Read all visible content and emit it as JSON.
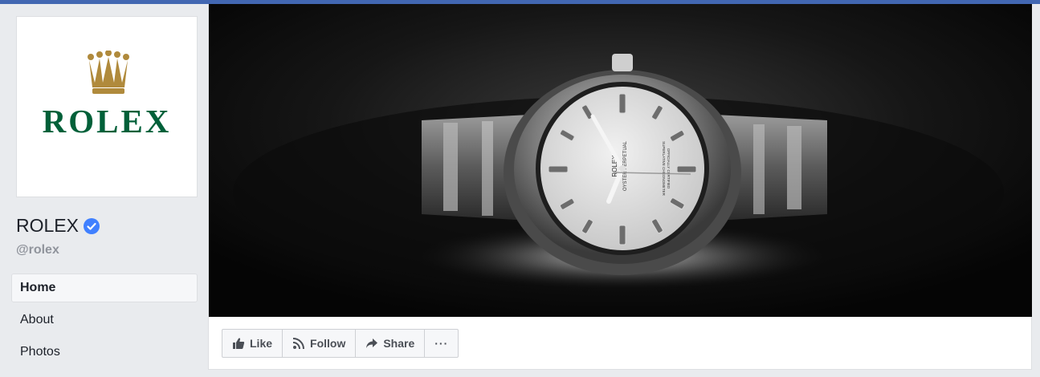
{
  "page": {
    "logo_text": "ROLEX",
    "name": "ROLEX",
    "handle": "@rolex",
    "verified": true
  },
  "nav": {
    "items": [
      {
        "label": "Home",
        "active": true
      },
      {
        "label": "About",
        "active": false
      },
      {
        "label": "Photos",
        "active": false
      }
    ]
  },
  "actions": {
    "like": "Like",
    "follow": "Follow",
    "share": "Share",
    "more": "···"
  },
  "cover": {
    "dial_brand": "ROLEX",
    "dial_line": "OYSTER PERPETUAL",
    "dial_cert_1": "SUPERLATIVE CHRONOMETER",
    "dial_cert_2": "OFFICIALLY CERTIFIED"
  },
  "colors": {
    "topbar": "#4267b2",
    "rolex_green": "#006039",
    "crown_gold": "#b08a3c",
    "verified_blue": "#4080ff"
  },
  "icons": {
    "verified": "verified-badge-icon",
    "like": "thumbs-up-icon",
    "follow": "rss-icon",
    "share": "share-arrow-icon",
    "crown": "rolex-crown-icon"
  }
}
